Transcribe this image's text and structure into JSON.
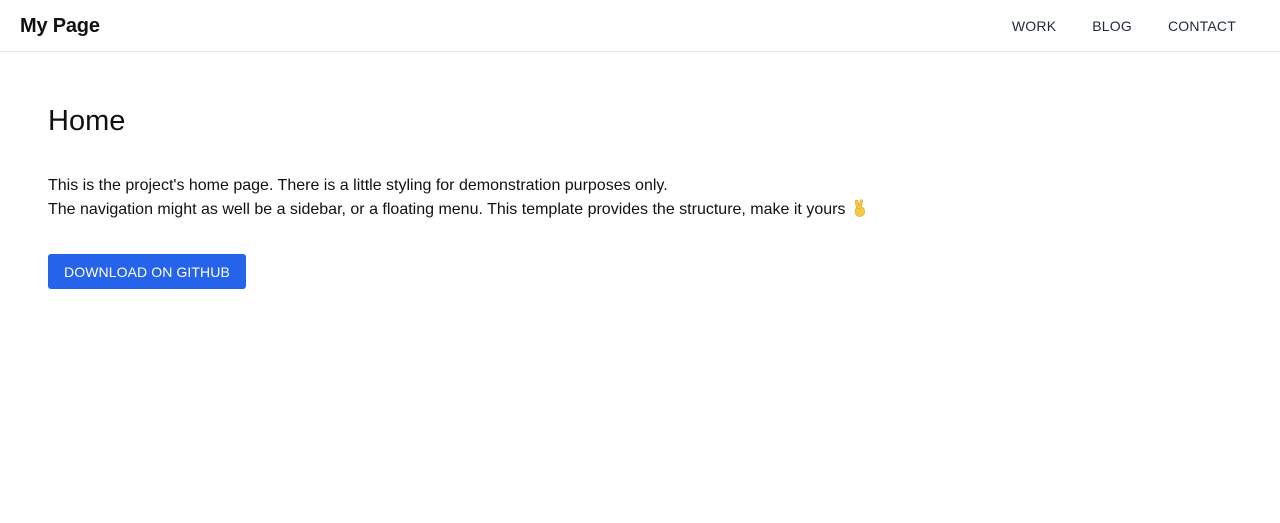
{
  "header": {
    "brand": "My Page",
    "nav": [
      {
        "label": "WORK"
      },
      {
        "label": "BLOG"
      },
      {
        "label": "CONTACT"
      }
    ]
  },
  "main": {
    "heading": "Home",
    "paragraph_line_1": "This is the project's home page. There is a little styling for demonstration purposes only.",
    "paragraph_line_2": "The navigation might as well be a sidebar, or a floating menu. This template provides the structure, make it yours",
    "emoji_icon": "victory-hand-icon",
    "button_label": "DOWNLOAD ON GITHUB"
  },
  "colors": {
    "button_bg": "#2563eb",
    "border": "#e5e7eb",
    "text": "#111111"
  }
}
